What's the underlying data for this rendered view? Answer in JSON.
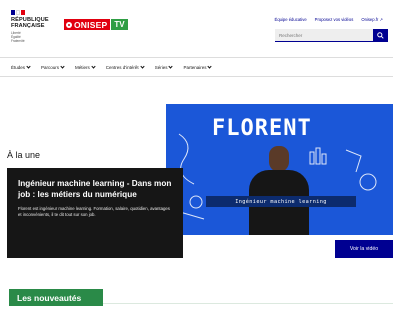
{
  "header": {
    "gov": {
      "lines": [
        "RÉPUBLIQUE",
        "FRANÇAISE"
      ],
      "motto": [
        "Liberté",
        "Égalité",
        "Fraternité"
      ],
      "flag_colors": [
        "#000091",
        "#ffffff",
        "#e1000f"
      ]
    },
    "brand": {
      "name": "ONISEP",
      "tv": "TV"
    },
    "tools": [
      "Équipe éducative",
      "Proposez vos vidéos",
      "Onisep.fr"
    ],
    "search": {
      "placeholder": "Rechercher",
      "icon": "search-icon"
    }
  },
  "nav": {
    "items": [
      "Études",
      "Parcours",
      "Métiers",
      "Centres d'intérêt",
      "Séries",
      "Partenaires"
    ]
  },
  "hero": {
    "section_label": "À la une",
    "video": {
      "overlay_title": "FLORENT",
      "overlay_subtitle": "Ingénieur machine learning"
    },
    "card": {
      "title": "Ingénieur machine learning - Dans mon job : les métiers du numérique",
      "description": "Florent est ingénieur machine learning. Formation, salaire, quotidien, avantages et inconvénients, il te dit tout sur son job."
    },
    "watch_label": "Voir la vidéo"
  },
  "news": {
    "label": "Les nouveautés"
  },
  "colors": {
    "primary": "#000091",
    "accent_red": "#e1000f",
    "green": "#2a8a48",
    "video_bg": "#1b57d8"
  }
}
